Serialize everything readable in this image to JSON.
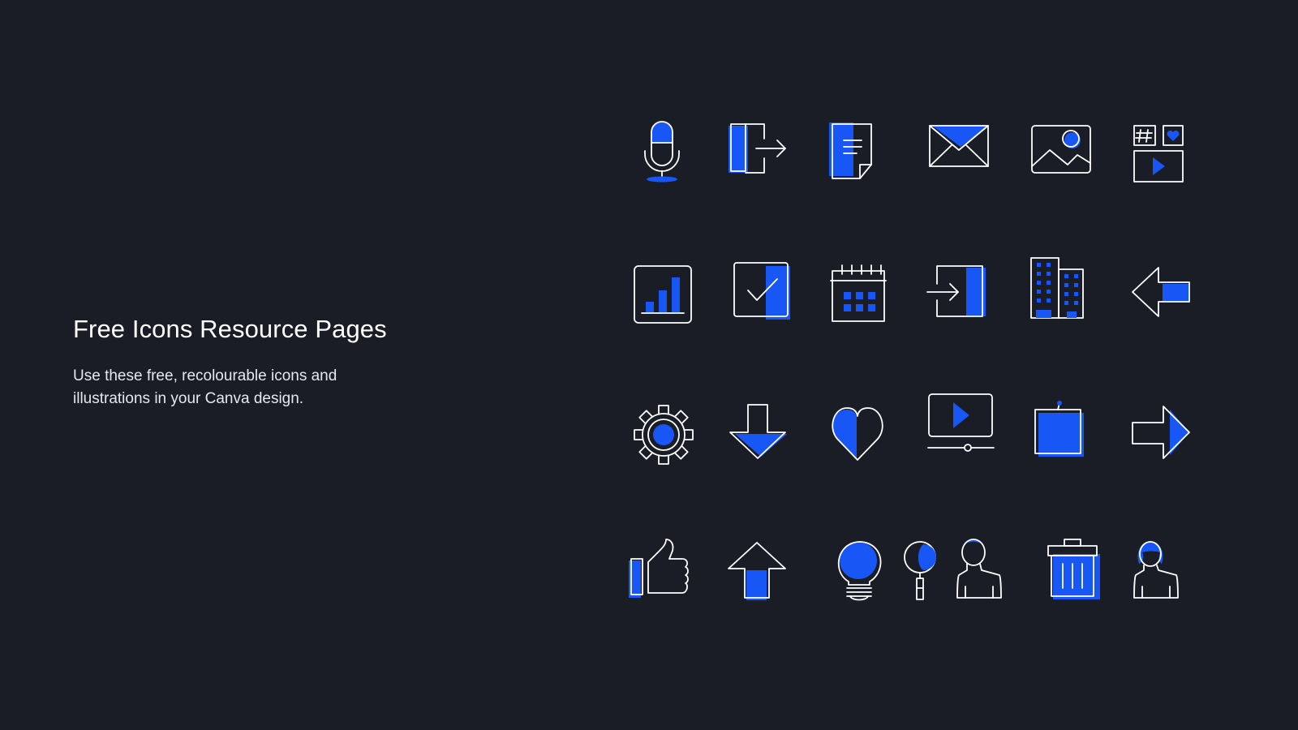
{
  "intro": {
    "title": "Free Icons Resource Pages",
    "description": "Use these free, recolourable icons and illustrations in your Canva design."
  },
  "colors": {
    "background": "#1a1c26",
    "accent": "#1857f6",
    "line": "#ffffff"
  },
  "icons": [
    "microphone-icon",
    "exit-door-icon",
    "document-icon",
    "envelope-icon",
    "image-icon",
    "social-media-icon",
    "bar-chart-icon",
    "checkbox-icon",
    "calendar-icon",
    "login-icon",
    "buildings-icon",
    "arrow-left-icon",
    "gear-icon",
    "arrow-down-icon",
    "heart-icon",
    "video-player-icon",
    "sticky-note-icon",
    "arrow-right-icon",
    "thumbs-up-icon",
    "arrow-up-icon",
    "lightbulb-icon",
    "magnifier-icon",
    "user-icon",
    "trash-can-icon",
    "user-woman-icon"
  ]
}
